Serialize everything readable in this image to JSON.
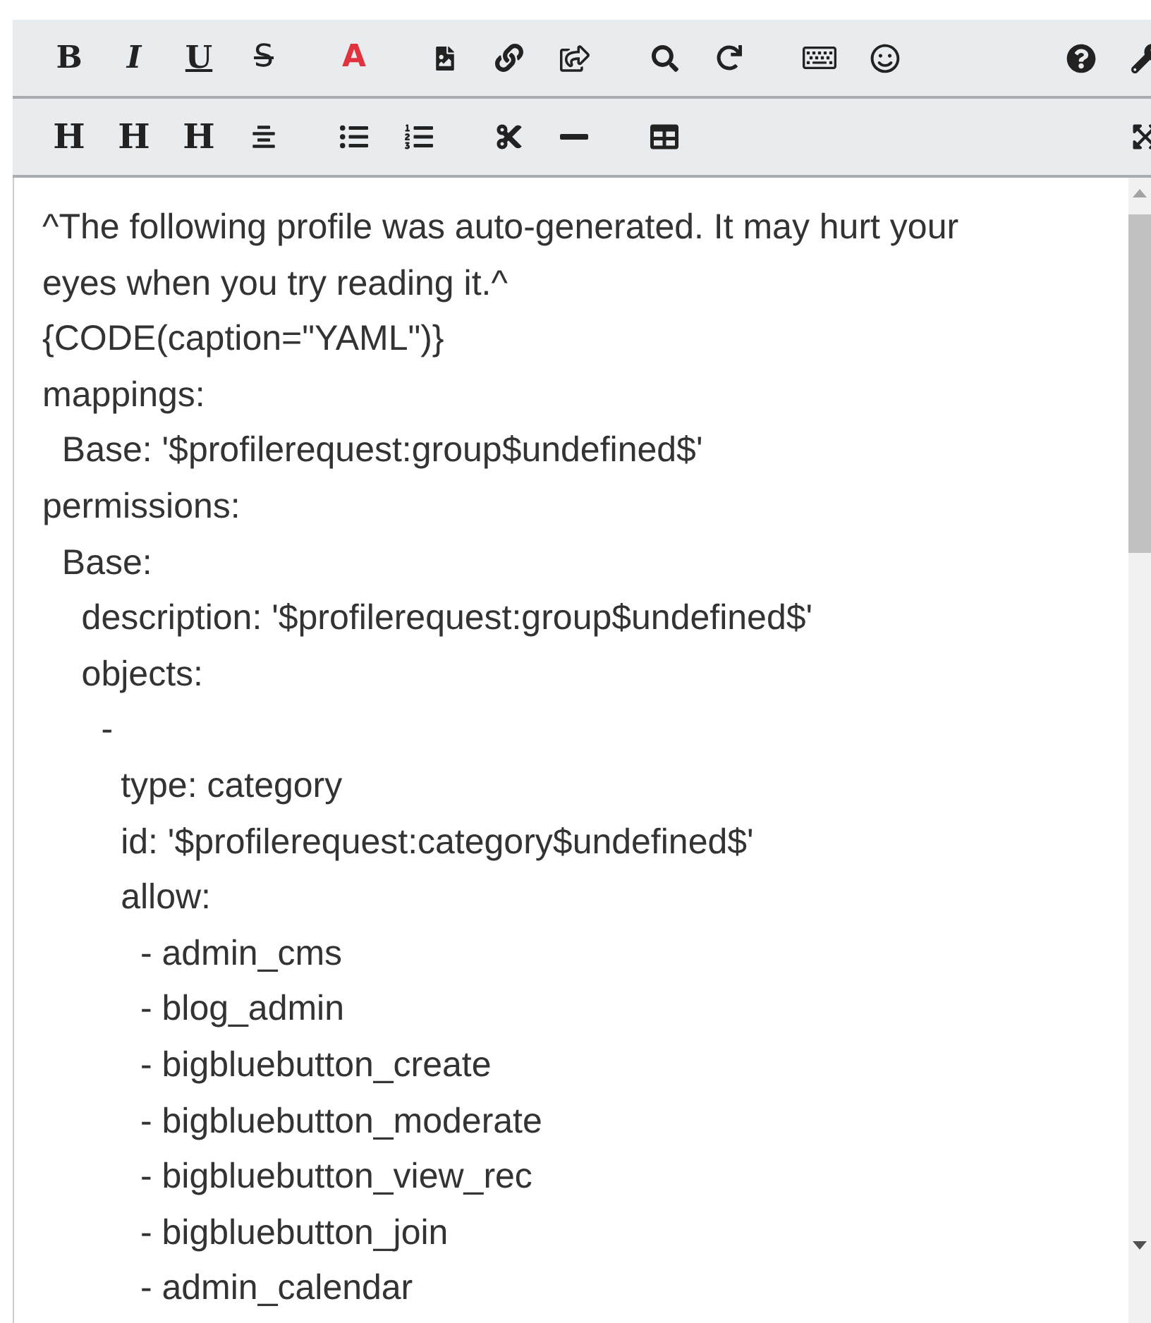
{
  "toolbars": [
    {
      "groups": [
        [
          {
            "kind": "bold",
            "label": "B"
          },
          {
            "kind": "italic",
            "label": "I"
          },
          {
            "kind": "underline",
            "label": "U"
          },
          {
            "kind": "strike",
            "label": "S"
          }
        ],
        [
          {
            "kind": "color",
            "label": "A"
          }
        ],
        [
          {
            "kind": "icon"
          },
          {
            "kind": "icon"
          },
          {
            "kind": "icon"
          }
        ],
        [
          {
            "kind": "icon"
          },
          {
            "kind": "icon"
          }
        ],
        [
          {
            "kind": "icon"
          },
          {
            "kind": "icon"
          }
        ],
        [
          {
            "kind": "icon"
          },
          {
            "kind": "icon"
          }
        ]
      ]
    },
    {
      "groups": [
        [
          {
            "kind": "heading",
            "label": "H"
          },
          {
            "kind": "heading",
            "label": "H"
          },
          {
            "kind": "heading",
            "label": "H"
          },
          {
            "kind": "icon"
          }
        ],
        [
          {
            "kind": "icon"
          },
          {
            "kind": "icon"
          }
        ],
        [
          {
            "kind": "icon"
          },
          {
            "kind": "icon"
          }
        ],
        [
          {
            "kind": "icon"
          }
        ],
        [
          {
            "kind": "icon"
          }
        ]
      ]
    }
  ],
  "editor": {
    "lines": [
      "^The following profile was auto-generated. It may hurt your eyes when you try reading it.^",
      "{CODE(caption=\"YAML\")}",
      "mappings:",
      "  Base: '$profilerequest:group$undefined$'",
      "permissions:",
      "  Base:",
      "    description: '$profilerequest:group$undefined$'",
      "    objects:",
      "      -",
      "        type: category",
      "        id: '$profilerequest:category$undefined$'",
      "        allow:",
      "          - admin_cms",
      "          - blog_admin",
      "          - bigbluebutton_create",
      "          - bigbluebutton_moderate",
      "          - bigbluebutton_view_rec",
      "          - bigbluebutton_join",
      "          - admin_calendar"
    ]
  }
}
